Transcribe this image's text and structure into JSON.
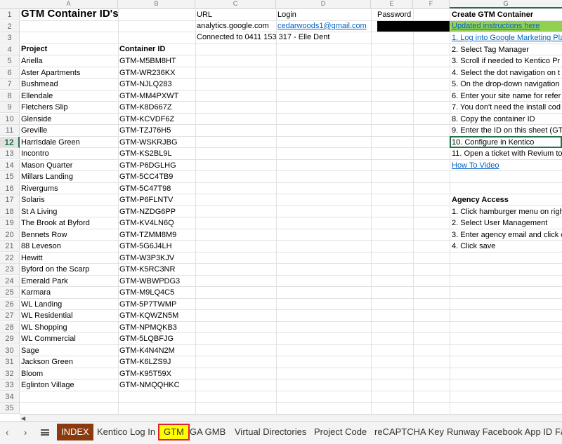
{
  "column_headers": [
    "A",
    "B",
    "C",
    "D",
    "E",
    "F",
    "G"
  ],
  "selected_row": "12",
  "cells": {
    "title": "GTM Container ID's",
    "url_label": "URL",
    "url_value": "analytics.google.com",
    "connected": "Connected to 0411 153 317 - Elle Dent",
    "login_label": "Login",
    "login_value": "cedarwoods1@gmail.com",
    "password_label": "Password",
    "project_header": "Project",
    "container_header": "Container ID"
  },
  "projects": [
    {
      "name": "Ariella",
      "id": "GTM-M5BM8HT"
    },
    {
      "name": "Aster Apartments",
      "id": "GTM-WR236KX"
    },
    {
      "name": "Bushmead",
      "id": "GTM-NJLQ283"
    },
    {
      "name": "Ellendale",
      "id": "GTM-MM4PXWT"
    },
    {
      "name": "Fletchers Slip",
      "id": "GTM-K8D667Z"
    },
    {
      "name": "Glenside",
      "id": "GTM-KCVDF6Z"
    },
    {
      "name": "Greville",
      "id": "GTM-TZJ76H5"
    },
    {
      "name": "Harrisdale Green",
      "id": "GTM-WSKRJBG"
    },
    {
      "name": "Incontro",
      "id": "GTM-KS2BL9L"
    },
    {
      "name": "Mason Quarter",
      "id": "GTM-P6DGLHG"
    },
    {
      "name": "Millars Landing",
      "id": "GTM-5CC4TB9"
    },
    {
      "name": "Rivergums",
      "id": "GTM-5C47T98"
    },
    {
      "name": "Solaris",
      "id": "GTM-P6FLNTV"
    },
    {
      "name": "St A Living",
      "id": "GTM-NZDG6PP"
    },
    {
      "name": "The Brook at Byford",
      "id": "GTM-KV4LN6Q"
    },
    {
      "name": "Bennets Row",
      "id": "GTM-TZMM8M9"
    },
    {
      "name": "88 Leveson",
      "id": "GTM-5G6J4LH"
    },
    {
      "name": "Hewitt",
      "id": "GTM-W3P3KJV"
    },
    {
      "name": "Byford on the Scarp",
      "id": "GTM-K5RC3NR"
    },
    {
      "name": "Emerald Park",
      "id": "GTM-WBWPDG3"
    },
    {
      "name": "Karmara",
      "id": "GTM-M9LQ4C5"
    },
    {
      "name": "WL Landing",
      "id": "GTM-5P7TWMP"
    },
    {
      "name": "WL Residential",
      "id": "GTM-KQWZN5M"
    },
    {
      "name": "WL Shopping",
      "id": "GTM-NPMQKB3"
    },
    {
      "name": "WL Commercial",
      "id": "GTM-5LQBFJG"
    },
    {
      "name": "Sage",
      "id": "GTM-K4N4N2M"
    },
    {
      "name": "Jackson Green",
      "id": "GTM-K6LZS9J"
    },
    {
      "name": "Bloom",
      "id": "GTM-K95T59X"
    },
    {
      "name": "Eglinton Village",
      "id": "GTM-NMQQHKC"
    }
  ],
  "instructions": {
    "create_title": "Create GTM Container",
    "updated_link": "Updated instructions here",
    "steps": [
      "1. Log into Google Marketing Pla",
      "2. Select Tag Manager",
      "3.  Scroll if needed to  Kentico Pr",
      "4.  Select the dot navigation on t",
      "5. On the drop-down navigation",
      "6. Enter your site name for refer",
      "7. You don't need the install cod",
      "8. Copy the container ID",
      "9. Enter the ID on this sheet (GT",
      "10. Configure in Kentico",
      "11. Open a ticket with Revium to"
    ],
    "video_link": "How To Video",
    "agency_title": "Agency Access",
    "agency_steps": [
      "1. Click hamburger menu on righ",
      "2. Select User Management",
      "3. Enter agency email and click c",
      "4. Click save"
    ]
  },
  "tabs": [
    "INDEX",
    "Kentico Log In",
    "GTM",
    "GA GMB",
    "Virtual Directories",
    "Project Code",
    "reCAPTCHA Key",
    "Runway Facebook App ID",
    "Fa"
  ],
  "active_tab": "GTM",
  "colors": {
    "index_tab": "#8b3a0f",
    "gtm_tab": "#ffff00",
    "gtm_tab_border": "#e0202a",
    "green_fill": "#92d050",
    "link": "#0563c1",
    "selection": "#217346"
  },
  "icons": {
    "prev_sheet": "chevron-left-icon",
    "next_sheet": "chevron-right-icon",
    "sheet_menu": "menu-icon"
  }
}
